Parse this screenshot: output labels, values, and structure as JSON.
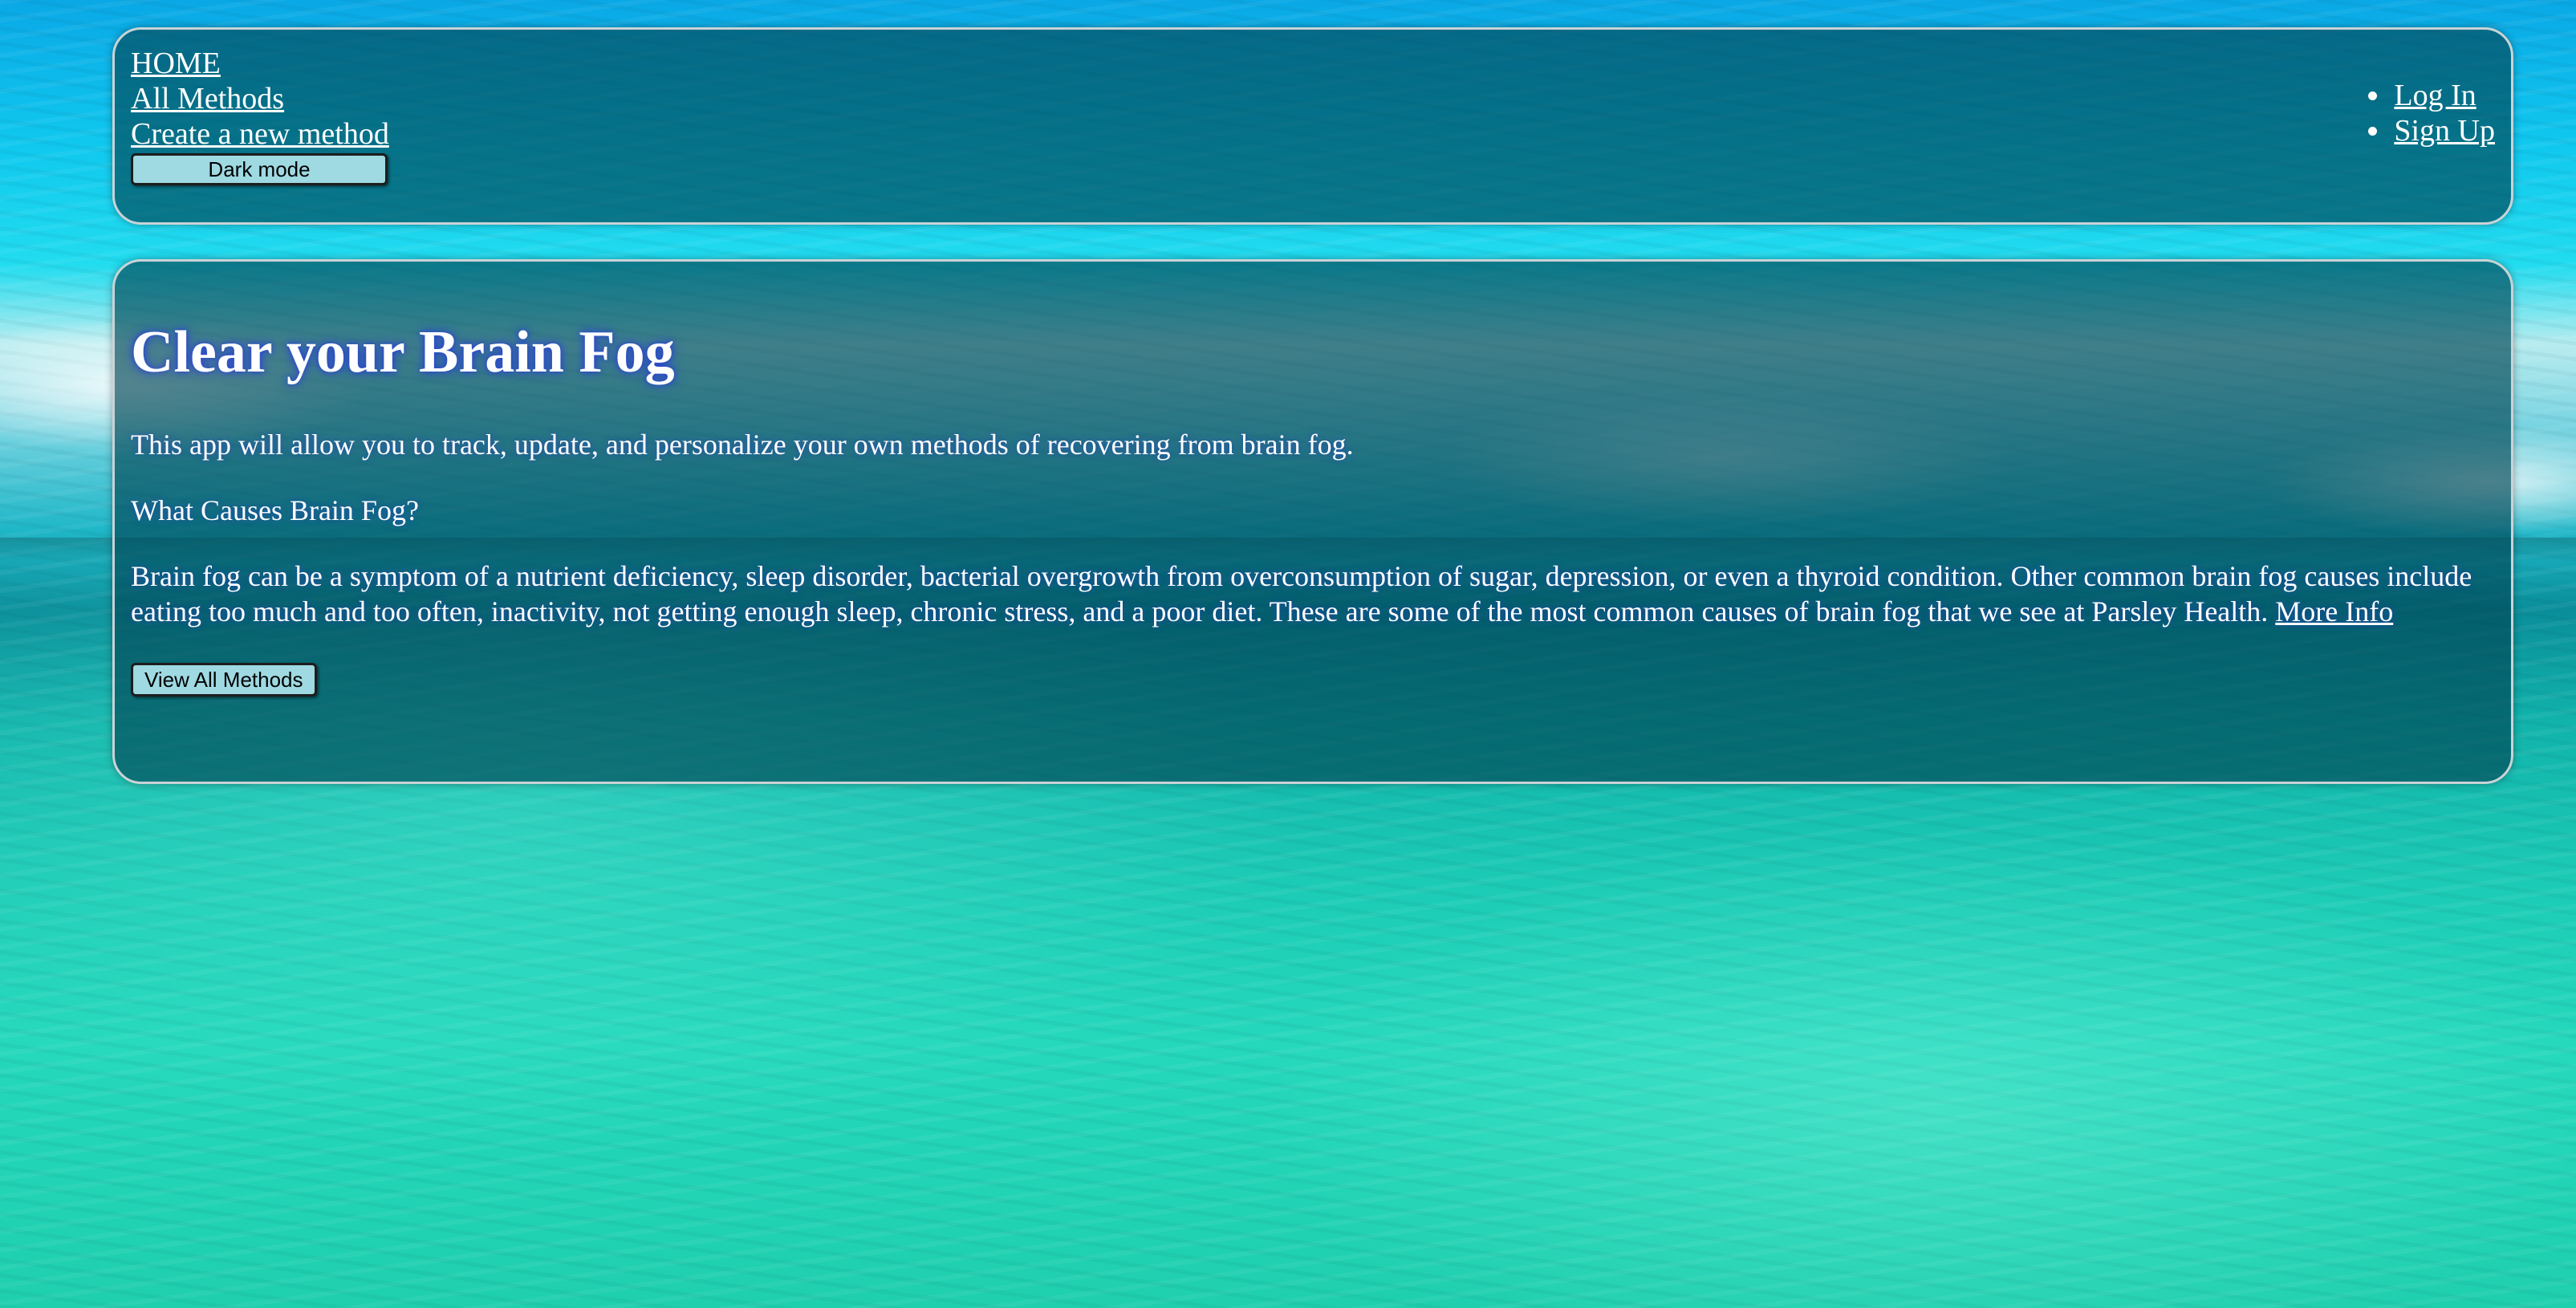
{
  "nav": {
    "left_links": [
      {
        "label": "HOME"
      },
      {
        "label": "All Methods"
      },
      {
        "label": "Create a new method"
      }
    ],
    "dark_mode_label": "Dark mode",
    "right_links": [
      {
        "label": "Log In"
      },
      {
        "label": "Sign Up"
      }
    ]
  },
  "hero": {
    "title": "Clear your Brain Fog",
    "intro": "This app will allow you to track, update, and personalize your own methods of recovering from brain fog.",
    "question": "What Causes Brain Fog?",
    "causes_text": "Brain fog can be a symptom of a nutrient deficiency, sleep disorder, bacterial overgrowth from overconsumption of sugar, depression, or even a thyroid condition. Other common brain fog causes include eating too much and too often, inactivity, not getting enough sleep, chronic stress, and a poor diet. These are some of the most common causes of brain fog that we see at Parsley Health.",
    "more_info_label": "More Info",
    "view_all_label": "View All Methods"
  },
  "colors": {
    "panel_bg": "#004655",
    "button_bg": "#9fd9e2",
    "title_glow": "#283cdc"
  }
}
